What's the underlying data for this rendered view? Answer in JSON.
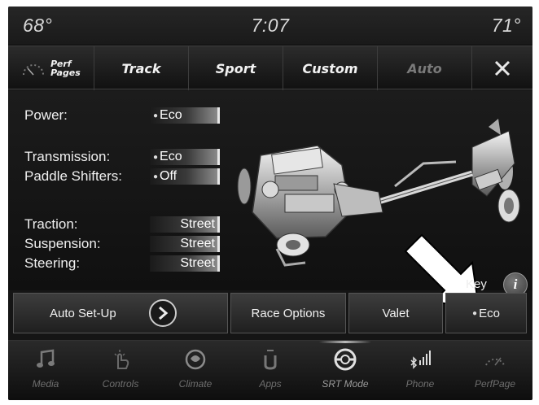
{
  "status": {
    "temp_left": "68°",
    "clock": "7:07",
    "temp_right": "71°"
  },
  "tabs": {
    "perf_line1": "Perf",
    "perf_line2": "Pages",
    "track": "Track",
    "sport": "Sport",
    "custom": "Custom",
    "auto": "Auto",
    "close_icon": "close-x-icon"
  },
  "settings": [
    {
      "label": "Power:",
      "value": "Eco"
    },
    {
      "label": "Transmission:",
      "value": "Eco"
    },
    {
      "label": "Paddle Shifters:",
      "value": "Off"
    },
    {
      "label": "Traction:",
      "value": "Street"
    },
    {
      "label": "Suspension:",
      "value": "Street"
    },
    {
      "label": "Steering:",
      "value": "Street"
    }
  ],
  "key": {
    "label": "Key",
    "info": "i"
  },
  "buttons": {
    "auto_setup": "Auto Set-Up",
    "race_options": "Race Options",
    "valet": "Valet",
    "eco": "Eco"
  },
  "nav": [
    {
      "label": "Media",
      "icon": "music-note-icon"
    },
    {
      "label": "Controls",
      "icon": "hand-touch-icon"
    },
    {
      "label": "Climate",
      "icon": "climate-icon"
    },
    {
      "label": "Apps",
      "icon": "apps-icon"
    },
    {
      "label": "SRT Mode",
      "icon": "steering-wheel-icon",
      "active": true
    },
    {
      "label": "Phone",
      "icon": "bluetooth-signal-icon"
    },
    {
      "label": "PerfPage",
      "icon": "gauge-icon"
    }
  ]
}
